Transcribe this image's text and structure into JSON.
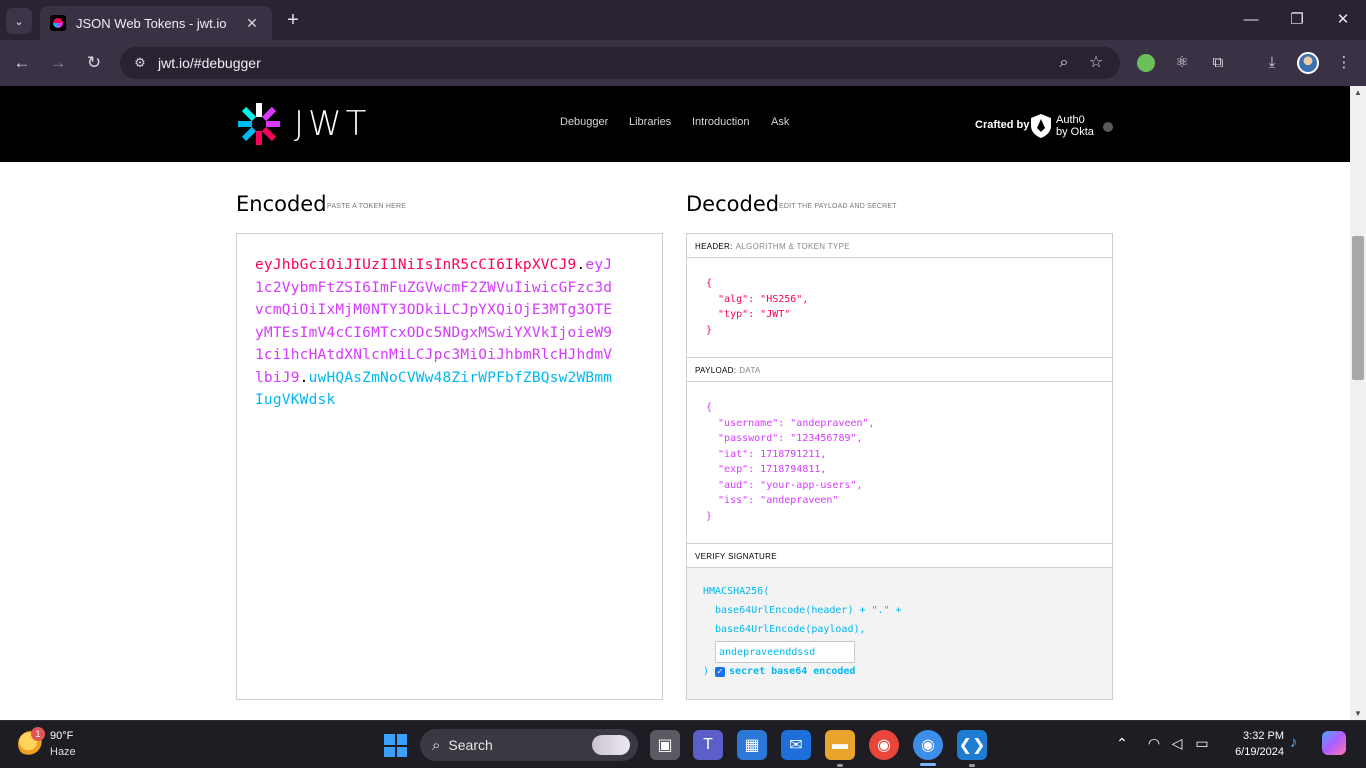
{
  "browser": {
    "tab_title": "JSON Web Tokens - jwt.io",
    "tab_close": "✕",
    "new_tab": "+",
    "tab_menu": "⌄",
    "url": "jwt.io/#debugger",
    "window_controls": {
      "minimize": "—",
      "maximize": "❐",
      "close": "✕"
    }
  },
  "site": {
    "logo_text": "JWT",
    "nav": [
      "Debugger",
      "Libraries",
      "Introduction",
      "Ask"
    ],
    "crafted_by": "Crafted by",
    "auth0_line1": "Auth0",
    "auth0_line2": "by Okta"
  },
  "encoded": {
    "title": "Encoded",
    "subtitle": "PASTE A TOKEN HERE",
    "token_header": "eyJhbGciOiJIUzI1NiIsInR5cCI6IkpXVCJ9",
    "token_payload": "eyJ1c2VybmFtZSI6ImFuZGVwcmF2ZWVuIiwicGFzc3dvcmQiOiIxMjM0NTY3ODkiLCJpYXQiOjE3MTg3OTEyMTEsImV4cCI6MTcxODc5NDgxMSwiYXVkIjoieW91ci1hcHAtdXNlcnMiLCJpc3MiOiJhbmRlcHJhdmVlbiJ9",
    "token_signature": "uwHQAsZmNoCVWw48ZirWPFbfZBQsw2WBmmIugVKWdsk",
    "dot": "."
  },
  "decoded": {
    "title": "Decoded",
    "subtitle": "EDIT THE PAYLOAD AND SECRET",
    "header_label": "HEADER:",
    "header_sub": "ALGORITHM & TOKEN TYPE",
    "header_json": "{\n  \"alg\": \"HS256\",\n  \"typ\": \"JWT\"\n}",
    "payload_label": "PAYLOAD:",
    "payload_sub": "DATA",
    "payload_json": "{\n  \"username\": \"andepraveen\",\n  \"password\": \"123456789\",\n  \"iat\": 1718791211,\n  \"exp\": 1718794811,\n  \"aud\": \"your-app-users\",\n  \"iss\": \"andepraveen\"\n}",
    "verify_label": "VERIFY SIGNATURE",
    "sig_line1": "HMACSHA256(",
    "sig_line2": "base64UrlEncode(header) + \".\" +",
    "sig_line3": "base64UrlEncode(payload),",
    "secret_value": "andepraveenddssd",
    "sig_close": ")",
    "checkbox_label": "secret base64 encoded",
    "checkbox_checked": true
  },
  "taskbar": {
    "weather_temp": "90°F",
    "weather_cond": "Haze",
    "weather_badge": "1",
    "search_label": "Search",
    "time": "3:32 PM",
    "date": "6/19/2024"
  },
  "colors": {
    "header_red": "#fb015b",
    "payload_purple": "#d63aff",
    "signature_cyan": "#00b9f1"
  }
}
